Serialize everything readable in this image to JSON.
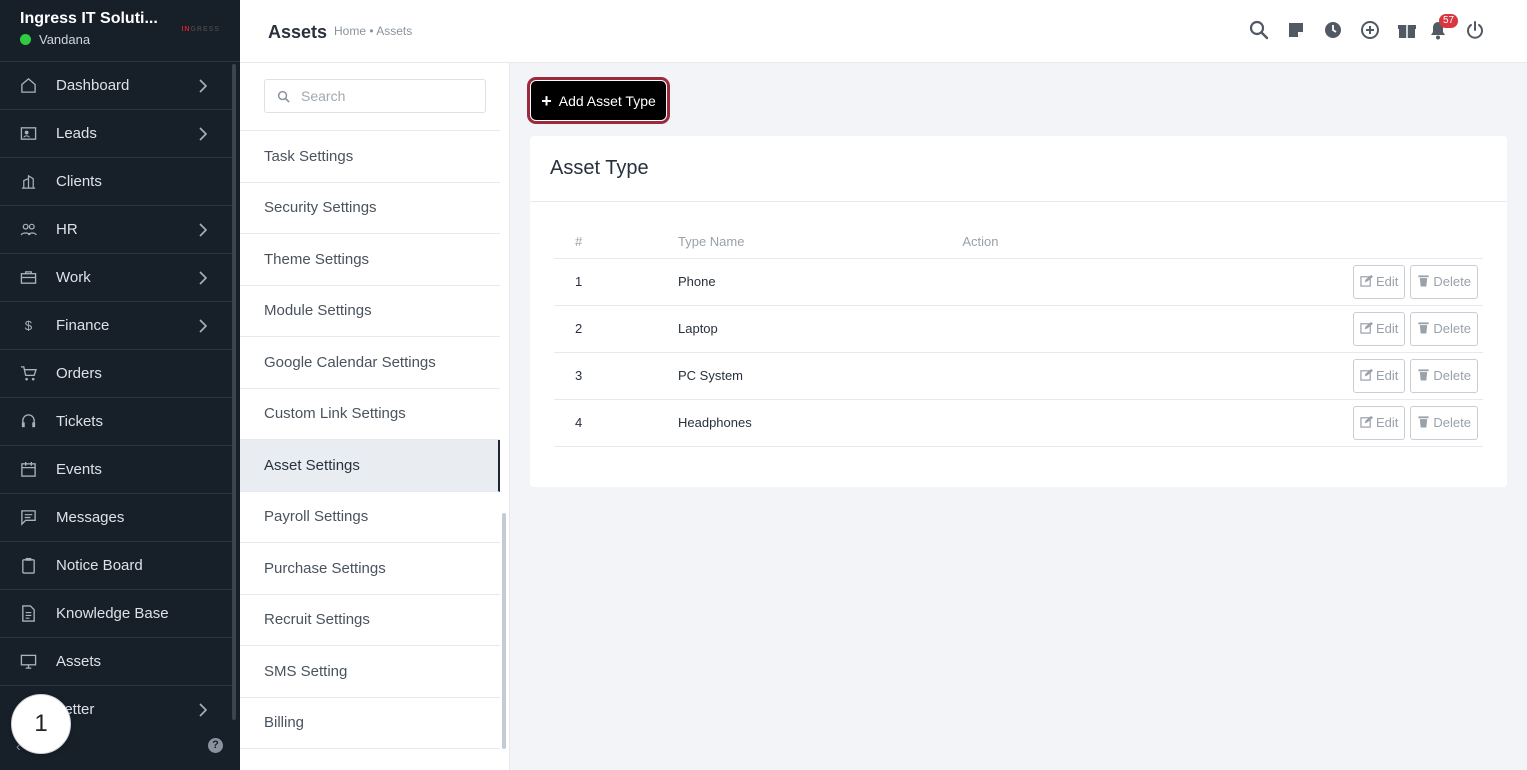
{
  "brand": {
    "name": "Ingress IT Soluti...",
    "user": "Vandana",
    "logo_text": "INGRESS"
  },
  "sidebar": {
    "items": [
      {
        "label": "Dashboard",
        "icon": "home-icon",
        "has_children": true
      },
      {
        "label": "Leads",
        "icon": "id-card-icon",
        "has_children": true
      },
      {
        "label": "Clients",
        "icon": "building-icon",
        "has_children": false
      },
      {
        "label": "HR",
        "icon": "people-icon",
        "has_children": true
      },
      {
        "label": "Work",
        "icon": "briefcase-icon",
        "has_children": true
      },
      {
        "label": "Finance",
        "icon": "dollar-icon",
        "has_children": true
      },
      {
        "label": "Orders",
        "icon": "cart-icon",
        "has_children": false
      },
      {
        "label": "Tickets",
        "icon": "headset-icon",
        "has_children": false
      },
      {
        "label": "Events",
        "icon": "calendar-icon",
        "has_children": false
      },
      {
        "label": "Messages",
        "icon": "chat-icon",
        "has_children": false
      },
      {
        "label": "Notice Board",
        "icon": "clipboard-icon",
        "has_children": false
      },
      {
        "label": "Knowledge Base",
        "icon": "document-icon",
        "has_children": false
      },
      {
        "label": "Assets",
        "icon": "monitor-icon",
        "has_children": false
      },
      {
        "label": "Letter",
        "icon": "letter-icon",
        "has_children": true
      }
    ],
    "step_badge": "1"
  },
  "header": {
    "title": "Assets",
    "breadcrumb": "Home • Assets",
    "notification_count": "57"
  },
  "settings": {
    "search_placeholder": "Search",
    "items": [
      "Task Settings",
      "Security Settings",
      "Theme Settings",
      "Module Settings",
      "Google Calendar Settings",
      "Custom Link Settings",
      "Asset Settings",
      "Payroll Settings",
      "Purchase Settings",
      "Recruit Settings",
      "SMS Setting",
      "Billing"
    ],
    "active": "Asset Settings"
  },
  "main": {
    "add_button": "Add Asset Type",
    "card_title": "Asset Type",
    "columns": [
      "#",
      "Type Name",
      "Action"
    ],
    "rows": [
      {
        "num": "1",
        "name": "Phone"
      },
      {
        "num": "2",
        "name": "Laptop"
      },
      {
        "num": "3",
        "name": "PC System"
      },
      {
        "num": "4",
        "name": "Headphones"
      }
    ],
    "edit_label": "Edit",
    "delete_label": "Delete"
  },
  "colors": {
    "sidebar_bg": "#171f29",
    "accent": "#000000",
    "highlight_border": "#9c2a3c",
    "badge": "#d9363e"
  }
}
